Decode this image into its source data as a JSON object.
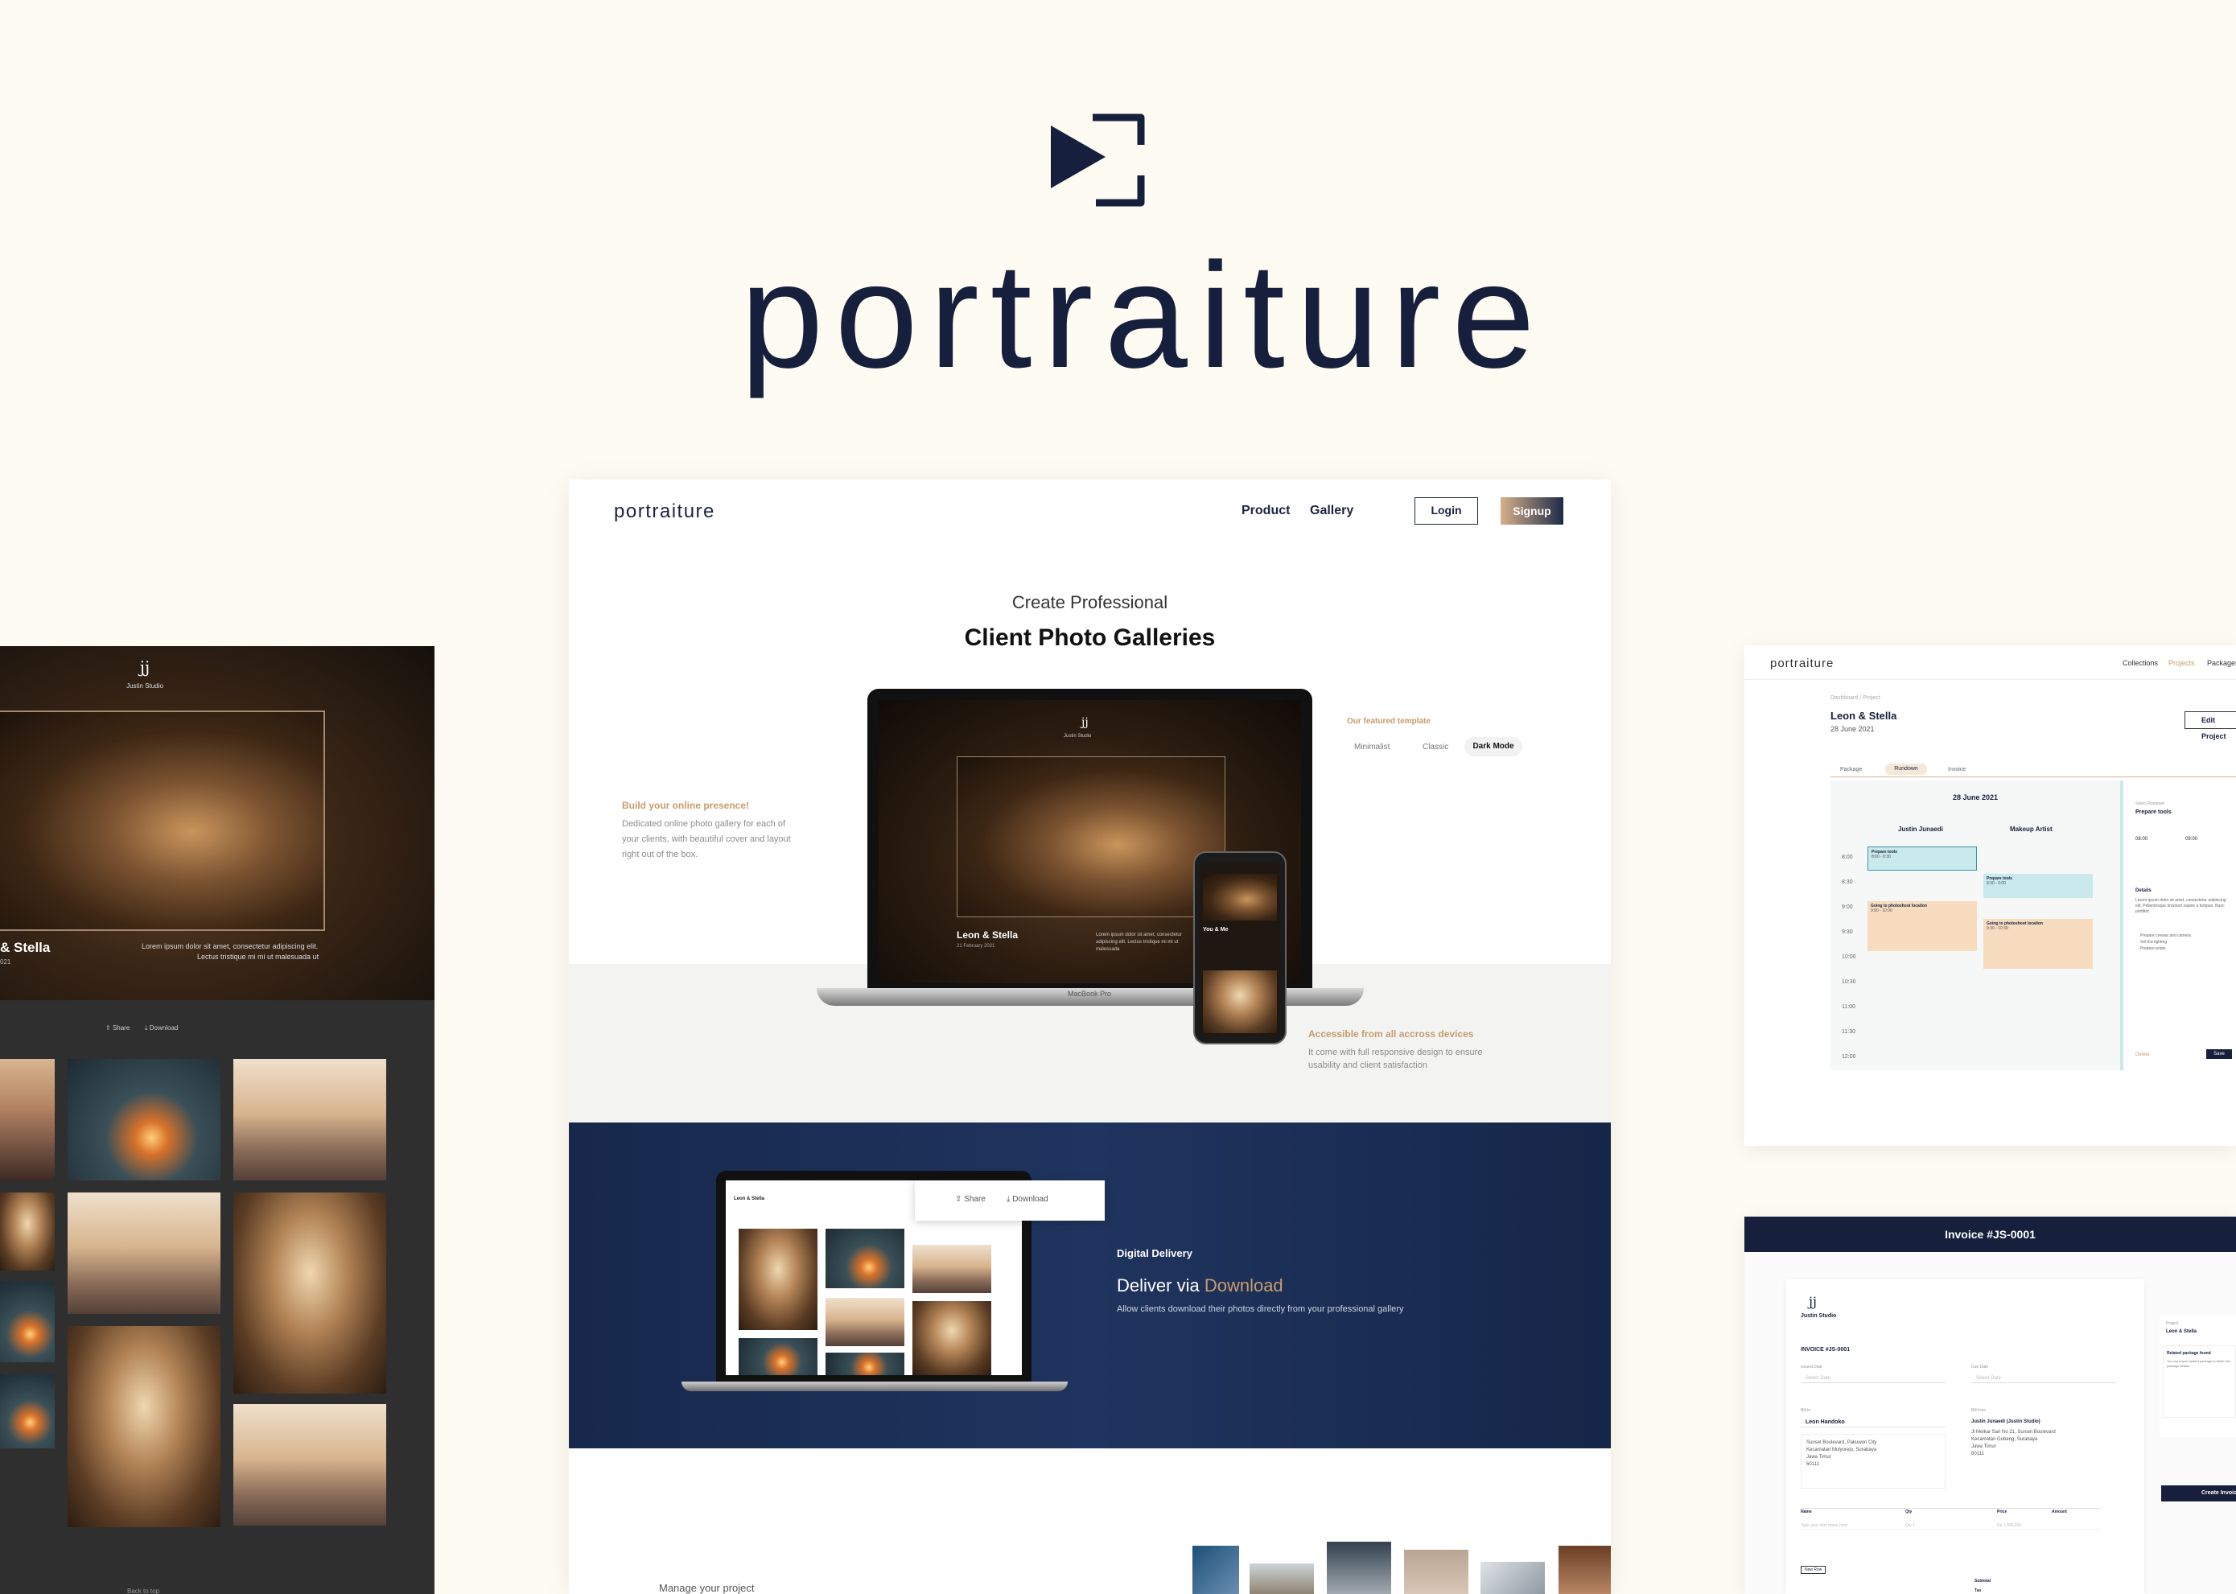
{
  "brand": {
    "name": "portraiture",
    "colors": {
      "navy": "#16203c",
      "cream": "#fefbf3",
      "gold": "#c89b6d"
    }
  },
  "left_gallery": {
    "studio_logo": "jj",
    "studio_name": "Justin Studio",
    "hero_title": "& Stella",
    "hero_date": "021",
    "hero_text_line1": "Lorem ipsum dolor sit amet, consectetur adipiscing elit.",
    "hero_text_line2": "Lectus tristique mi mi ut malesuada ut",
    "share_label": "Share",
    "download_label": "Download",
    "footer_label": "Back to top"
  },
  "landing": {
    "logo": "portraiture",
    "nav": {
      "product": "Product",
      "gallery": "Gallery",
      "login": "Login",
      "signup": "Signup"
    },
    "hero_subtitle": "Create Professional",
    "hero_title": "Client Photo Galleries",
    "laptop_brand": "MacBook Pro",
    "laptop_studio": "jj",
    "laptop_studio_name": "Justin Studio",
    "laptop_couple": "Leon & Stella",
    "laptop_date": "21 February 2021",
    "laptop_text": "Lorem ipsum dolor sit amet, consectetur adipiscing elit. Lectus tristique mi mi ut malesuada",
    "phone_couple": "You & Me",
    "feature_left": {
      "title": "Build your online presence!",
      "body_line1": "Dedicated online photo gallery for each of",
      "body_line2": "your clients, with beautiful cover and layout",
      "body_line3": "right out of the box."
    },
    "template": {
      "title": "Our featured template",
      "options": [
        "Minimalist",
        "Classic",
        "Dark Mode"
      ],
      "selected": "Dark Mode"
    },
    "feature_devices": {
      "title": "Accessible from all accross devices",
      "body_line1": "It come with full responsive design to ensure",
      "body_line2": "usability and client satisfaction"
    },
    "delivery": {
      "eyebrow": "Digital Delivery",
      "title_prefix": "Deliver via",
      "title_highlight": "Download",
      "body": "Allow clients download their photos directly from your professional gallery",
      "laptop_header": "Leon & Stella",
      "share_label": "Share",
      "download_label": "Download"
    },
    "manage_label": "Manage your project"
  },
  "project_panel": {
    "logo": "portraiture",
    "nav": [
      "Collections",
      "Projects",
      "Packages"
    ],
    "active_nav": "Projects",
    "breadcrumb": "Dashboard / Project",
    "title": "Leon & Stella",
    "date": "28 June 2021",
    "edit_button": "Edit Project",
    "tabs": [
      "Package",
      "Rundown",
      "Invoice"
    ],
    "active_tab": "Rundown",
    "schedule_date": "28 June 2021",
    "columns": [
      "Justin Junaedi",
      "Makeup Artist"
    ],
    "times": [
      "8:00",
      "8:30",
      "9:00",
      "9:30",
      "10:00",
      "10:30",
      "11:00",
      "11:30",
      "12:00"
    ],
    "events": [
      {
        "title": "Prepare tools",
        "time": "8:00 - 8:30",
        "column": 0,
        "color": "#c9e9ec"
      },
      {
        "title": "Prepare tools",
        "time": "8:30 - 9:00",
        "column": 1,
        "color": "#c9e9ec"
      },
      {
        "title": "Going to photoshoot location",
        "time": "9:00 - 10:00",
        "column": 0,
        "color": "#f7dcc0"
      },
      {
        "title": "Going to photoshoot location",
        "time": "9:30 - 10:30",
        "column": 1,
        "color": "#f7dcc0"
      }
    ],
    "side": {
      "label": "Select Rundown",
      "value": "Prepare tools",
      "start": "08:00",
      "end": "09:00",
      "details_label": "Details",
      "details_text": "Lorem ipsum dolor sit amet, consectetur adipiscing elit. Pellentesque tincidunt sapien a tempus. Nunc porttitor.",
      "bullet1": "Prepare crewas and camera",
      "bullet2": "Set the lighting",
      "bullet3": "Prepare props",
      "delete": "Delete",
      "save": "Save"
    }
  },
  "invoice_panel": {
    "header": "Invoice #JS-0001",
    "studio_logo": "jj",
    "studio_name": "Justin Studio",
    "invoice_no": "INVOICE #JS-0001",
    "issued_label": "Issued Date",
    "issued_value": "Select Date",
    "due_label": "Due Date",
    "due_value": "Select Date",
    "bill_to_label": "Bill to",
    "bill_to_name": "Leon Handoko",
    "bill_to_address": [
      "Sunset Boulevard, Pakuwon City",
      "Kecamatan Mulyorejo, Surabaya",
      "Jawa Timur",
      "60111"
    ],
    "bill_from_label": "Bill from",
    "bill_from_name": "Justin Junaedi (Justin Studio)",
    "bill_from_address": [
      "Jl Melkar Sari No 21, Sunset Boulevard",
      "Kecamatan Gubeng, Surabaya",
      "Jawa Timur",
      "60111"
    ],
    "table_headers": [
      "Name",
      "Qty",
      "Price",
      "Amount"
    ],
    "row_placeholder": [
      "Type your item name here",
      "Qty 1",
      "Rp 1,000,000"
    ],
    "new_row": "New Row",
    "subtotal": "Subtotal",
    "tax": "Tax",
    "side_label": "Project",
    "side_project": "Leon & Stella",
    "side_package_title": "Related package found",
    "side_package_text": "You can import related package to fasten the package details.",
    "create_button": "Create Invoice"
  }
}
